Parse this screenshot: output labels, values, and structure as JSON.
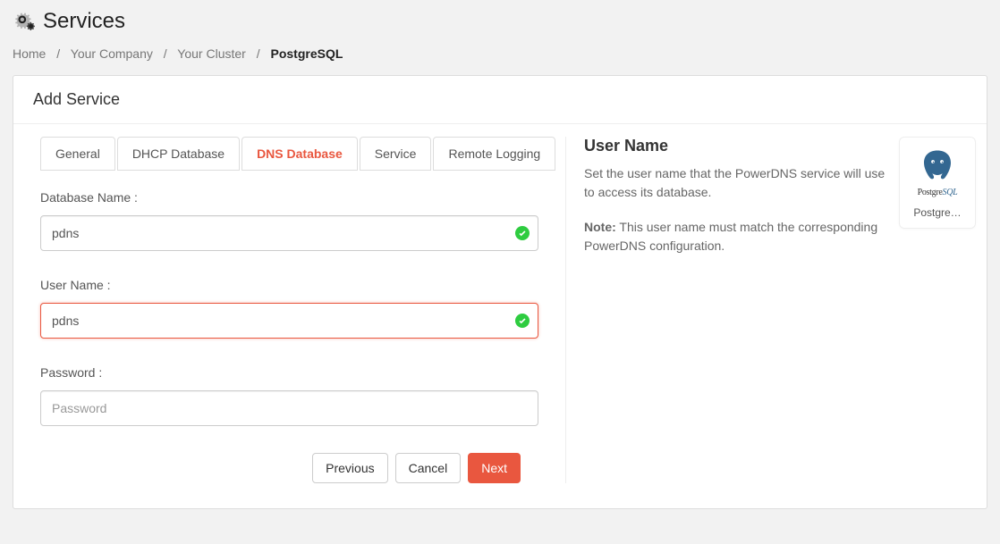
{
  "page": {
    "title": "Services"
  },
  "breadcrumb": {
    "items": [
      {
        "label": "Home"
      },
      {
        "label": "Your Company"
      },
      {
        "label": "Your Cluster"
      },
      {
        "label": "PostgreSQL"
      }
    ]
  },
  "panel": {
    "title": "Add Service"
  },
  "tabs": [
    {
      "label": "General"
    },
    {
      "label": "DHCP Database"
    },
    {
      "label": "DNS Database"
    },
    {
      "label": "Service"
    },
    {
      "label": "Remote Logging"
    }
  ],
  "form": {
    "dbname": {
      "label": "Database Name :",
      "value": "pdns",
      "valid": true
    },
    "username": {
      "label": "User Name :",
      "value": "pdns",
      "valid": true,
      "focused": true
    },
    "password": {
      "label": "Password :",
      "value": "",
      "placeholder": "Password"
    }
  },
  "buttons": {
    "previous": "Previous",
    "cancel": "Cancel",
    "next": "Next"
  },
  "help": {
    "title": "User Name",
    "text": "Set the user name that the PowerDNS service will use to access its database.",
    "note_label": "Note:",
    "note_text": " This user name must match the corresponding PowerDNS configuration."
  },
  "logo": {
    "brand_a": "Postgre",
    "brand_b": "SQL",
    "caption": "Postgre…"
  }
}
